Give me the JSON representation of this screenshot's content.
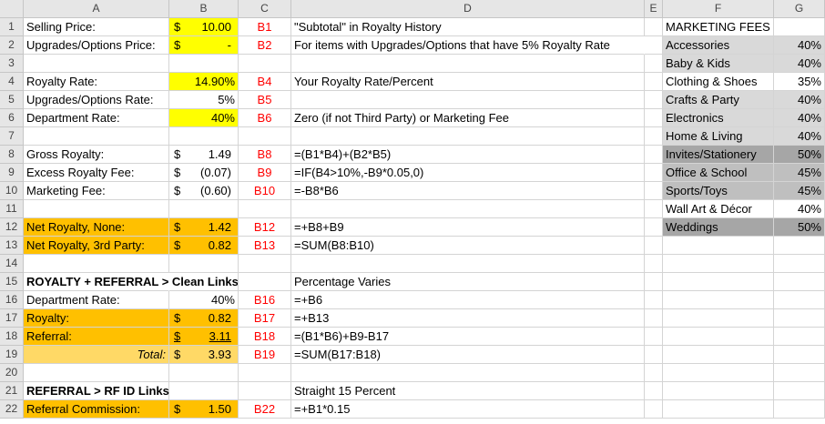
{
  "columns": [
    "A",
    "B",
    "C",
    "D",
    "E",
    "F",
    "G"
  ],
  "rows": [
    "1",
    "2",
    "3",
    "4",
    "5",
    "6",
    "7",
    "8",
    "9",
    "10",
    "11",
    "12",
    "13",
    "14",
    "15",
    "16",
    "17",
    "18",
    "19",
    "20",
    "21",
    "22"
  ],
  "r1": {
    "a": "Selling Price:",
    "b_sym": "$",
    "b_num": "10.00",
    "c": "B1",
    "d": "\"Subtotal\" in Royalty History",
    "f": "MARKETING FEES"
  },
  "r2": {
    "a": "Upgrades/Options Price:",
    "b_sym": "$",
    "b_num": "-",
    "c": "B2",
    "d": "For items with Upgrades/Options that have 5% Royalty Rate",
    "f": "Accessories",
    "g": "40%"
  },
  "r3": {
    "f": "Baby & Kids",
    "g": "40%"
  },
  "r4": {
    "a": "Royalty Rate:",
    "b": "14.90%",
    "c": "B4",
    "d": "Your Royalty Rate/Percent",
    "f": "Clothing & Shoes",
    "g": "35%"
  },
  "r5": {
    "a": "Upgrades/Options Rate:",
    "b": "5%",
    "c": "B5",
    "f": "Crafts & Party",
    "g": "40%"
  },
  "r6": {
    "a": "Department Rate:",
    "b": "40%",
    "c": "B6",
    "d": "Zero (if not Third Party) or Marketing Fee",
    "f": "Electronics",
    "g": "40%"
  },
  "r7": {
    "f": "Home & Living",
    "g": "40%"
  },
  "r8": {
    "a": "Gross Royalty:",
    "b_sym": "$",
    "b_num": "1.49",
    "c": "B8",
    "d": "=(B1*B4)+(B2*B5)",
    "f": "Invites/Stationery",
    "g": "50%"
  },
  "r9": {
    "a": "Excess Royalty Fee:",
    "b_sym": "$",
    "b_num": "(0.07)",
    "c": "B9",
    "d": "=IF(B4>10%,-B9*0.05,0)",
    "f": "Office & School",
    "g": "45%"
  },
  "r10": {
    "a": "Marketing Fee:",
    "b_sym": "$",
    "b_num": "(0.60)",
    "c": "B10",
    "d": "=-B8*B6",
    "f": "Sports/Toys",
    "g": "45%"
  },
  "r11": {
    "f": "Wall Art & Décor",
    "g": "40%"
  },
  "r12": {
    "a": "Net Royalty, None:",
    "b_sym": "$",
    "b_num": "1.42",
    "c": "B12",
    "d": "=+B8+B9",
    "f": "Weddings",
    "g": "50%"
  },
  "r13": {
    "a": "Net Royalty, 3rd Party:",
    "b_sym": "$",
    "b_num": "0.82",
    "c": "B13",
    "d": "=SUM(B8:B10)"
  },
  "r15": {
    "a": "ROYALTY + REFERRAL > Clean Links",
    "d": "Percentage Varies"
  },
  "r16": {
    "a": "Department Rate:",
    "b": "40%",
    "c": "B16",
    "d": "=+B6"
  },
  "r17": {
    "a": "Royalty:",
    "b_sym": "$",
    "b_num": "0.82",
    "c": "B17",
    "d": "=+B13"
  },
  "r18": {
    "a": "Referral:",
    "b_sym": "$",
    "b_num": "3.11",
    "c": "B18",
    "d": "=(B1*B6)+B9-B17"
  },
  "r19": {
    "a": "Total:",
    "b_sym": "$",
    "b_num": "3.93",
    "c": "B19",
    "d": "=SUM(B17:B18)"
  },
  "r21": {
    "a": "REFERRAL > RF ID Links",
    "d": "Straight 15 Percent"
  },
  "r22": {
    "a": "Referral Commission:",
    "b_sym": "$",
    "b_num": "1.50",
    "c": "B22",
    "d": "=+B1*0.15"
  }
}
